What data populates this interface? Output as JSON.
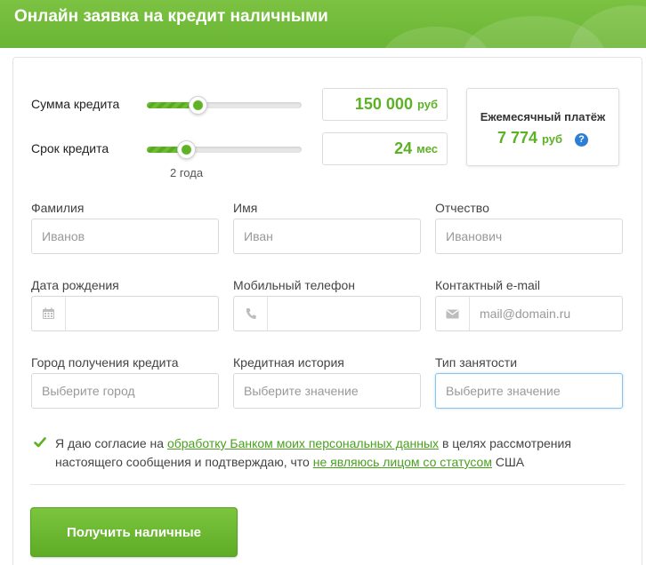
{
  "header": {
    "title": "Онлайн заявка на кредит наличными"
  },
  "sliders": {
    "amount": {
      "label": "Сумма кредита",
      "value": "150 000",
      "unit": "руб",
      "fill_fraction": 0.33
    },
    "term": {
      "label": "Срок кредита",
      "value": "24",
      "unit": "мес",
      "fill_fraction": 0.25,
      "note": "2 года"
    }
  },
  "payment": {
    "label": "Ежемесячный платёж",
    "value": "7 774",
    "unit": "руб",
    "help_glyph": "?"
  },
  "fields": {
    "surname": {
      "label": "Фамилия",
      "placeholder": "Иванов"
    },
    "name": {
      "label": "Имя",
      "placeholder": "Иван"
    },
    "patronymic": {
      "label": "Отчество",
      "placeholder": "Иванович"
    },
    "birthdate": {
      "label": "Дата рождения",
      "placeholder": "",
      "icon": "calendar-icon"
    },
    "phone": {
      "label": "Мобильный телефон",
      "placeholder": "",
      "icon": "phone-icon"
    },
    "email": {
      "label": "Контактный e-mail",
      "placeholder": "mail@domain.ru",
      "icon": "envelope-icon"
    },
    "city": {
      "label": "Город получения кредита",
      "placeholder": "Выберите город"
    },
    "credit_history": {
      "label": "Кредитная история",
      "placeholder": "Выберите значение"
    },
    "employment": {
      "label": "Тип занятости",
      "placeholder": "Выберите значение"
    }
  },
  "consent": {
    "checked": true,
    "text_1": "Я даю согласие на ",
    "link_1": "обработку Банком моих персональных данных",
    "text_2": " в целях рассмотрения настоящего сообщения и подтверждаю, что ",
    "link_2": "не являюсь лицом со статусом",
    "text_3": " США"
  },
  "submit": {
    "label": "Получить наличные"
  },
  "colors": {
    "brand_green": "#6ab534",
    "value_green": "#5db125",
    "link_green": "#4aa01e",
    "help_blue": "#2d7fd6"
  }
}
